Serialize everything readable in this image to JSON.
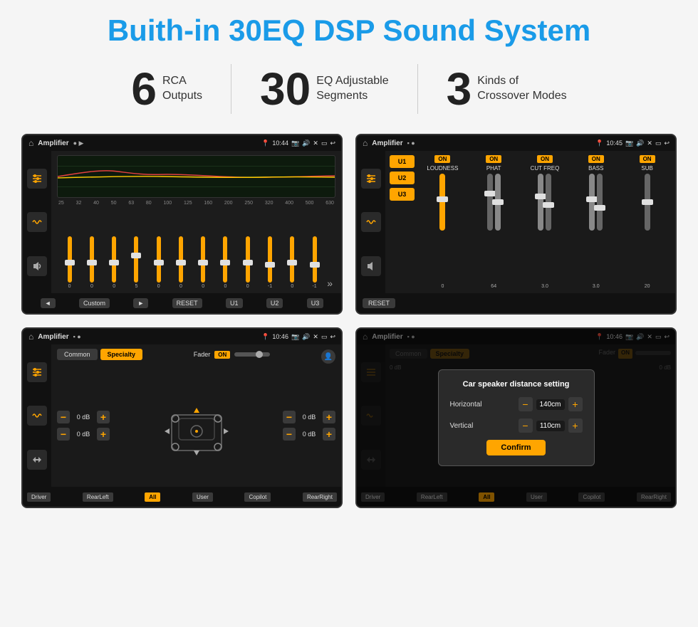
{
  "page": {
    "title": "Buith-in 30EQ DSP Sound System"
  },
  "stats": [
    {
      "number": "6",
      "label_line1": "RCA",
      "label_line2": "Outputs"
    },
    {
      "number": "30",
      "label_line1": "EQ Adjustable",
      "label_line2": "Segments"
    },
    {
      "number": "3",
      "label_line1": "Kinds of",
      "label_line2": "Crossover Modes"
    }
  ],
  "screen1": {
    "title": "Amplifier",
    "time": "10:44",
    "mode": "Custom",
    "freq_labels": [
      "25",
      "32",
      "40",
      "50",
      "63",
      "80",
      "100",
      "125",
      "160",
      "200",
      "250",
      "320",
      "400",
      "500",
      "630"
    ],
    "slider_values": [
      "0",
      "0",
      "0",
      "5",
      "0",
      "0",
      "0",
      "0",
      "0",
      "-1",
      "0",
      "-1"
    ],
    "buttons": [
      "◄",
      "Custom",
      "►",
      "RESET",
      "U1",
      "U2",
      "U3"
    ]
  },
  "screen2": {
    "title": "Amplifier",
    "time": "10:45",
    "presets": [
      "U1",
      "U2",
      "U3"
    ],
    "channels": [
      {
        "label": "LOUDNESS",
        "on": true
      },
      {
        "label": "PHAT",
        "on": true
      },
      {
        "label": "CUT FREQ",
        "on": true
      },
      {
        "label": "BASS",
        "on": true
      },
      {
        "label": "SUB",
        "on": true
      }
    ],
    "reset_label": "RESET"
  },
  "screen3": {
    "title": "Amplifier",
    "time": "10:46",
    "tabs": [
      "Common",
      "Specialty"
    ],
    "active_tab": "Specialty",
    "fader_label": "Fader",
    "fader_on": "ON",
    "vol_rows": [
      {
        "left": "0 dB",
        "right": "0 dB"
      },
      {
        "left": "0 dB",
        "right": "0 dB"
      }
    ],
    "bottom_buttons": [
      "Driver",
      "RearLeft",
      "All",
      "User",
      "Copilot",
      "RearRight"
    ]
  },
  "screen4": {
    "title": "Amplifier",
    "time": "10:46",
    "tabs": [
      "Common",
      "Specialty"
    ],
    "dialog": {
      "title": "Car speaker distance setting",
      "horizontal_label": "Horizontal",
      "horizontal_value": "140cm",
      "vertical_label": "Vertical",
      "vertical_value": "110cm",
      "confirm_label": "Confirm"
    },
    "bottom_buttons": [
      "Driver",
      "RearLeft",
      "All",
      "User",
      "Copilot",
      "RearRight"
    ]
  }
}
